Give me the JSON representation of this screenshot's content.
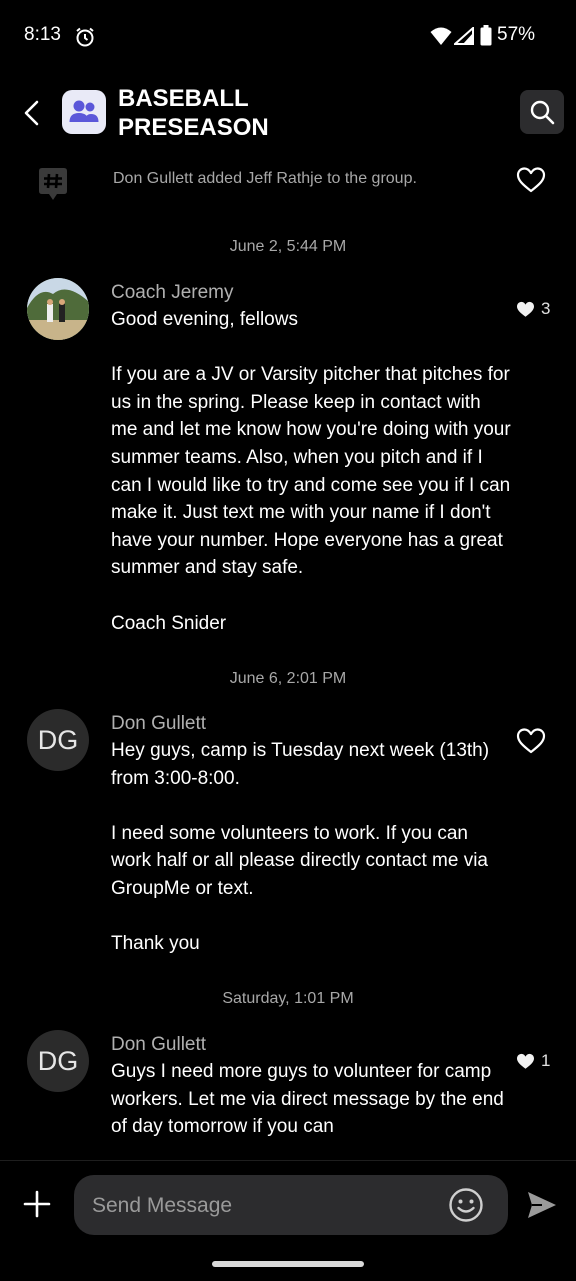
{
  "status_bar": {
    "time": "8:13",
    "battery": "57%"
  },
  "header": {
    "title": "BASEBALL PRESEASON"
  },
  "system_message": {
    "text": "Don Gullett added Jeff Rathje to the group."
  },
  "messages": [
    {
      "date": "June 2, 5:44 PM",
      "sender": "Coach Jeremy",
      "text": "Good evening, fellows\n\nIf you are a JV or Varsity pitcher that pitches for us in the spring. Please keep in contact with me and let me know how you're doing with your summer teams. Also, when you pitch and if I can I would like to try and come see you if I can make it. Just text me with your name if I don't have your number. Hope everyone has a great summer and stay safe.\n\nCoach Snider",
      "likes": "3"
    },
    {
      "date": "June 6, 2:01 PM",
      "sender": "Don Gullett",
      "initials": "DG",
      "text": "Hey guys, camp is Tuesday next week (13th) from 3:00-8:00.\n\nI need some volunteers to work. If you can work half or all please directly contact me via GroupMe or text.\n\nThank you"
    },
    {
      "date": "Saturday, 1:01 PM",
      "sender": "Don Gullett",
      "initials": "DG",
      "text": "Guys I need more guys to volunteer for camp workers. Let me via direct message by the end of day tomorrow if you can",
      "likes": "1"
    }
  ],
  "composer": {
    "placeholder": "Send Message"
  }
}
